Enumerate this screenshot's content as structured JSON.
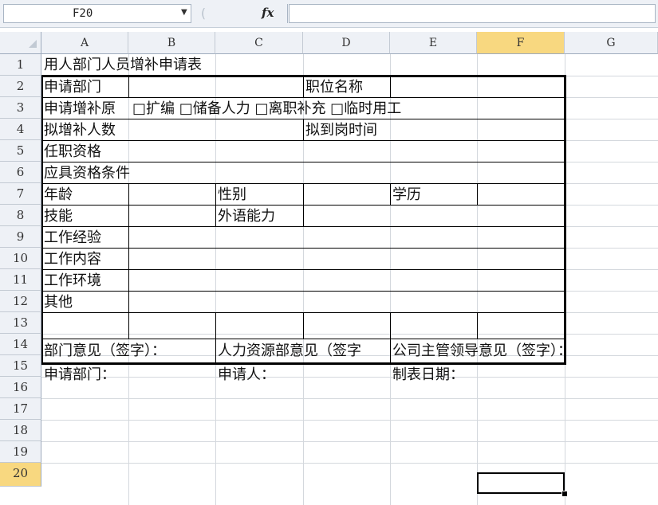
{
  "formula_bar": {
    "name_box": "F20",
    "fx_label": "fx",
    "formula": ""
  },
  "columns": [
    "A",
    "B",
    "C",
    "D",
    "E",
    "F",
    "G"
  ],
  "selected_column": "F",
  "rows": [
    "1",
    "2",
    "3",
    "4",
    "5",
    "6",
    "7",
    "8",
    "9",
    "10",
    "11",
    "12",
    "13",
    "14",
    "15",
    "16",
    "17",
    "18",
    "19",
    "20"
  ],
  "selected_row": "20",
  "cells": {
    "A1": "用人部门人员增补申请表",
    "A2": "申请部门",
    "D2": "职位名称",
    "A3": "申请增补原",
    "B3": "□扩编 □储备人力 □离职补充 □临时用工",
    "A4": "拟增补人数",
    "D4": "拟到岗时间",
    "A5": "任职资格",
    "A6": "应具资格条件",
    "A7": "年龄",
    "C7": "性别",
    "E7": "学历",
    "A8": "技能",
    "C8": "外语能力",
    "A9": "工作经验",
    "A10": "工作内容",
    "A11": "工作环境",
    "A12": "其他",
    "A14": "部门意见（签字）：",
    "C14": "人力资源部意见（签字",
    "E14": "公司主管领导意见（签字）：",
    "A15": "申请部门：",
    "C15": "申请人：",
    "E15": "制表日期："
  }
}
